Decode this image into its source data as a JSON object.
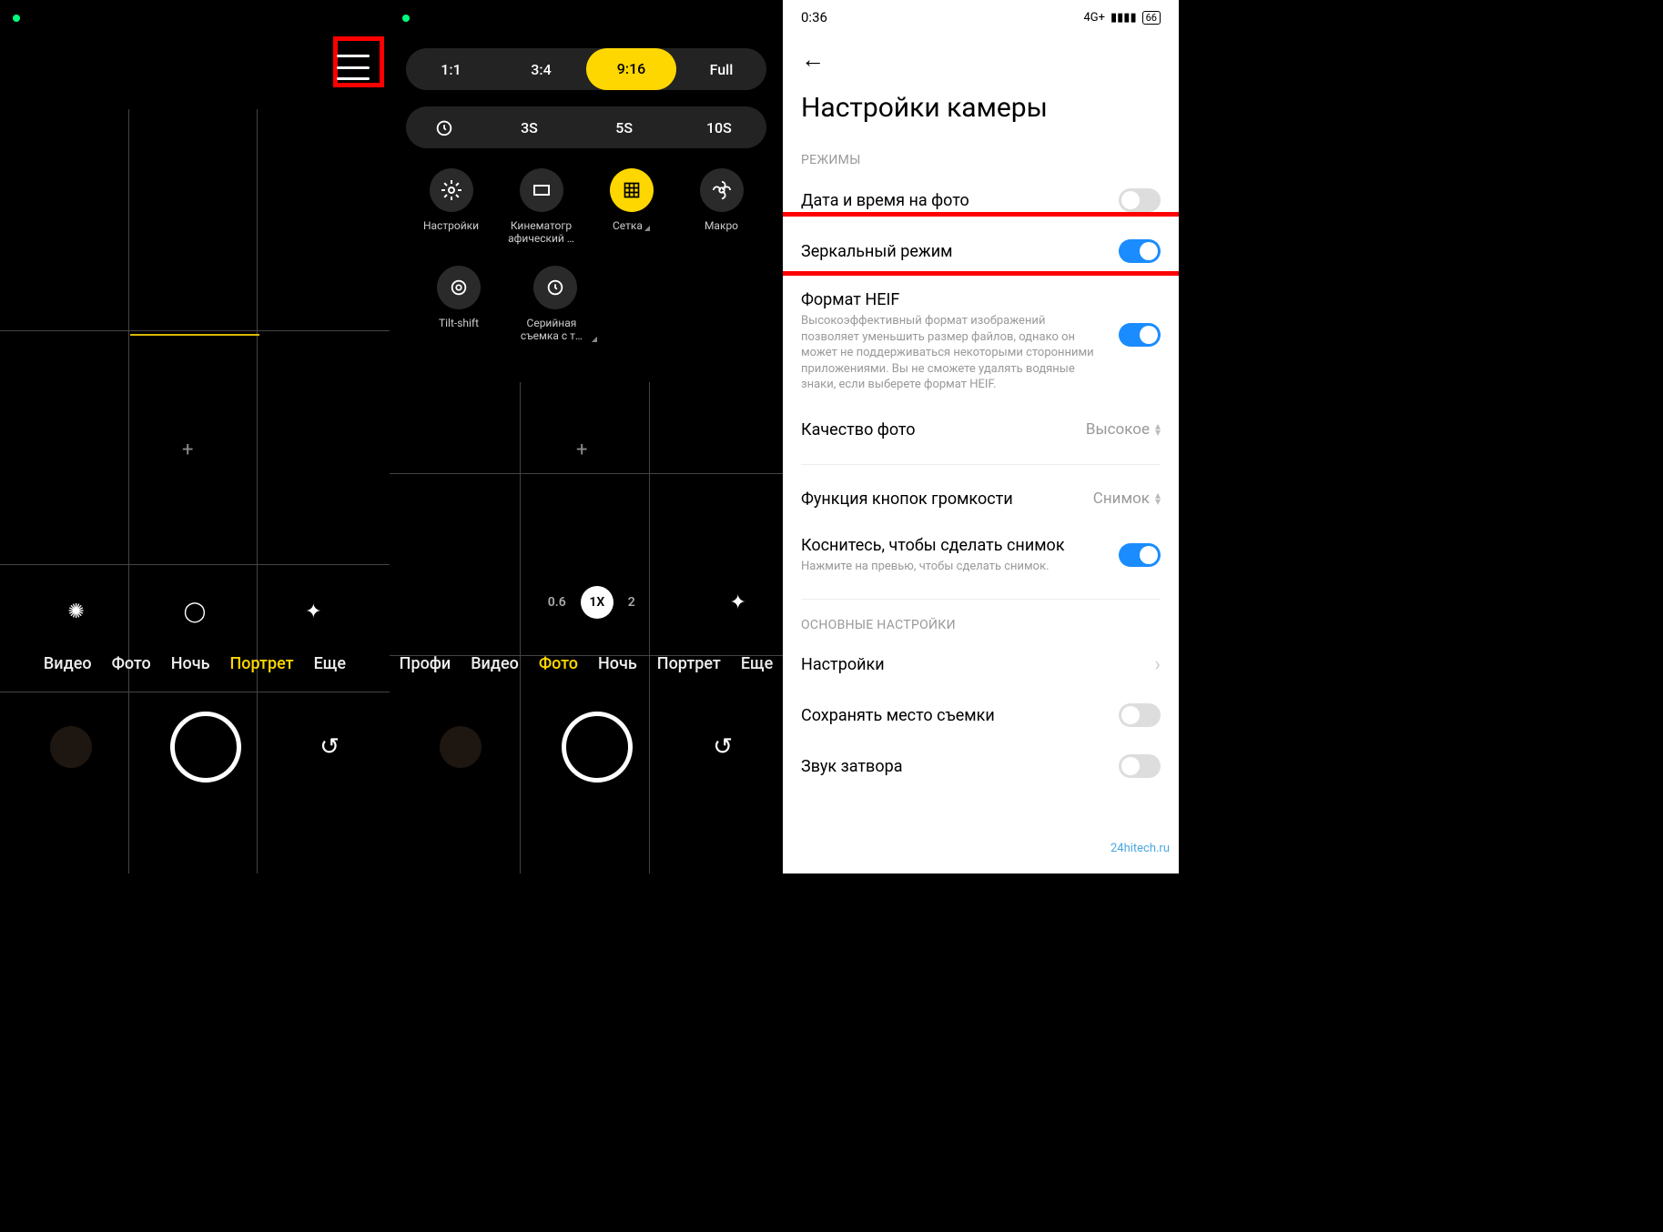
{
  "pane1": {
    "modes": [
      "Видео",
      "Фото",
      "Ночь",
      "Портрет",
      "Еще"
    ],
    "active_mode_index": 3
  },
  "pane2": {
    "aspect": {
      "options": [
        "1:1",
        "3:4",
        "9:16",
        "Full"
      ],
      "active_index": 2
    },
    "timer": {
      "options": [
        "3S",
        "5S",
        "10S"
      ],
      "icon": "timer"
    },
    "caps_row1": [
      {
        "label": "Настройки",
        "icon": "gear",
        "active": false
      },
      {
        "label": "Кинематогр афический …",
        "icon": "crop",
        "active": false
      },
      {
        "label": "Сетка",
        "icon": "grid",
        "active": true,
        "caret": true
      },
      {
        "label": "Макро",
        "icon": "flower",
        "active": false
      }
    ],
    "caps_row2": [
      {
        "label": "Tilt-shift",
        "icon": "target"
      },
      {
        "label": "Серийная съемка с т…",
        "icon": "burst",
        "caret": true
      }
    ],
    "zoom": {
      "options": [
        "0.6",
        "1X",
        "2"
      ],
      "active_index": 1
    },
    "modes": [
      "Профи",
      "Видео",
      "Фото",
      "Ночь",
      "Портрет",
      "Еще"
    ],
    "active_mode_index": 2
  },
  "pane3": {
    "status": {
      "time": "0:36",
      "network": "4G+",
      "battery": "66"
    },
    "title": "Настройки камеры",
    "sections": {
      "modes_header": "РЕЖИМЫ",
      "main_header": "ОСНОВНЫЕ НАСТРОЙКИ"
    },
    "items": {
      "date": {
        "title": "Дата и время на фото",
        "toggle": false
      },
      "mirror": {
        "title": "Зеркальный режим",
        "toggle": true
      },
      "heif": {
        "title": "Формат HEIF",
        "sub": "Высокоэффективный формат изображений позволяет уменьшить размер файлов, однако он может не поддерживаться некоторыми сторонними приложениями. Вы не сможете удалять водяные знаки, если выберете формат HEIF.",
        "toggle": true
      },
      "quality": {
        "title": "Качество фото",
        "value": "Высокое"
      },
      "volume": {
        "title": "Функция кнопок громкости",
        "value": "Снимок"
      },
      "tap": {
        "title": "Коснитесь, чтобы сделать снимок",
        "sub": "Нажмите на превью, чтобы сделать снимок.",
        "toggle": true
      },
      "settings_link": {
        "title": "Настройки"
      },
      "location": {
        "title": "Сохранять место съемки",
        "toggle": false
      },
      "shutter_sound": {
        "title": "Звук затвора",
        "toggle": false
      }
    },
    "watermark": "24hitech.ru"
  }
}
